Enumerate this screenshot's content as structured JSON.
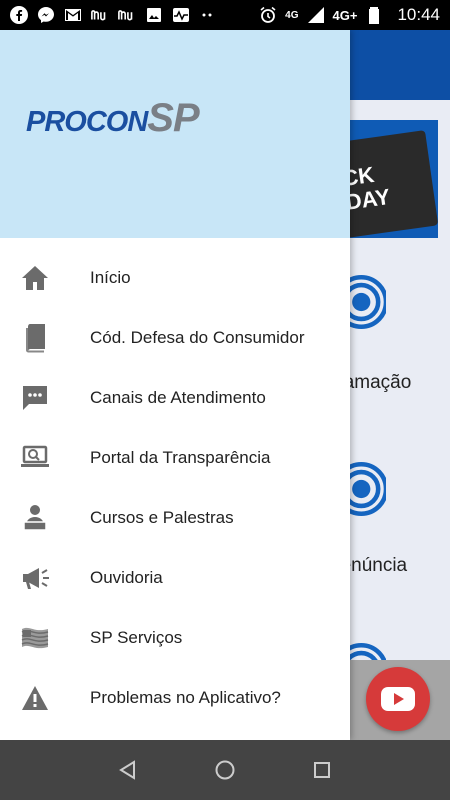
{
  "status_bar": {
    "time": "10:44",
    "network_label_1": "4G",
    "network_label_2": "4G+",
    "icons": [
      "facebook-icon",
      "messenger-icon",
      "gmail-icon",
      "nu-icon",
      "nu-icon",
      "gallery-icon",
      "activity-icon",
      "more-icon",
      "alarm-icon",
      "signal-icon",
      "battery-icon"
    ]
  },
  "drawer": {
    "logo": {
      "procon": "PROCON",
      "sp": "SP"
    },
    "menu": [
      {
        "label": "Início",
        "icon": "home-icon"
      },
      {
        "label": "Cód. Defesa do Consumidor",
        "icon": "book-icon"
      },
      {
        "label": "Canais de Atendimento",
        "icon": "chat-icon"
      },
      {
        "label": "Portal da Transparência",
        "icon": "laptop-search-icon"
      },
      {
        "label": "Cursos e Palestras",
        "icon": "teacher-icon"
      },
      {
        "label": "Ouvidoria",
        "icon": "megaphone-icon"
      },
      {
        "label": "SP Serviços",
        "icon": "flag-icon"
      },
      {
        "label": "Problemas no Aplicativo?",
        "icon": "warning-icon"
      }
    ]
  },
  "background_app": {
    "banner_text_1": "CK",
    "banner_text_2": "DAY",
    "label_1": "clamação",
    "label_2": "denúncia"
  },
  "colors": {
    "header_blue": "#0d4fa5",
    "drawer_header": "#c8e6f7",
    "icon_gray": "#6b6b6b",
    "youtube_red": "#d63a3a"
  },
  "nav_bar": {
    "icons": [
      "back-icon",
      "home-nav-icon",
      "recents-icon"
    ]
  }
}
